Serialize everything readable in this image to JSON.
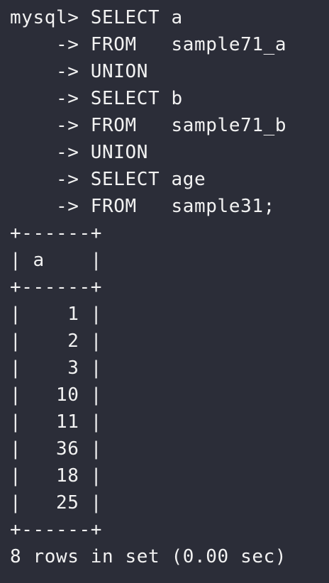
{
  "terminal": {
    "lines": [
      "mysql> SELECT a",
      "    -> FROM   sample71_a",
      "    -> UNION",
      "    -> SELECT b",
      "    -> FROM   sample71_b",
      "    -> UNION",
      "    -> SELECT age",
      "    -> FROM   sample31;",
      "+------+",
      "| a    |",
      "+------+",
      "|    1 |",
      "|    2 |",
      "|    3 |",
      "|   10 |",
      "|   11 |",
      "|   36 |",
      "|   18 |",
      "|   25 |",
      "+------+",
      "8 rows in set (0.00 sec)"
    ]
  },
  "colors": {
    "background": "#2b2d38",
    "text": "#f2f2f2"
  }
}
